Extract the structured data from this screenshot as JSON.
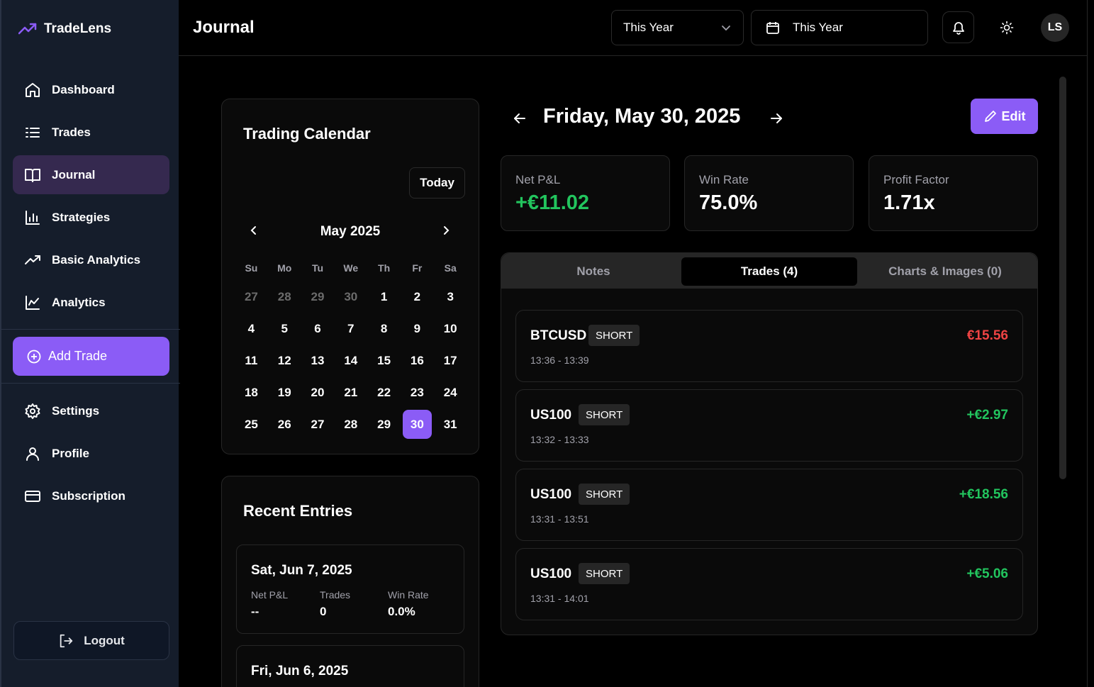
{
  "brand": {
    "name": "TradeLens"
  },
  "sidebar": {
    "items": [
      {
        "label": "Dashboard",
        "icon": "home-icon"
      },
      {
        "label": "Trades",
        "icon": "list-icon"
      },
      {
        "label": "Journal",
        "icon": "book-icon",
        "active": true
      },
      {
        "label": "Strategies",
        "icon": "bar-chart-icon"
      },
      {
        "label": "Basic Analytics",
        "icon": "trending-up-icon"
      },
      {
        "label": "Analytics",
        "icon": "line-chart-icon"
      }
    ],
    "add_trade": "Add Trade",
    "items2": [
      {
        "label": "Settings",
        "icon": "gear-icon"
      },
      {
        "label": "Profile",
        "icon": "user-icon"
      },
      {
        "label": "Subscription",
        "icon": "credit-card-icon"
      }
    ],
    "logout": "Logout"
  },
  "header": {
    "title": "Journal",
    "period_select": "This Year",
    "date_range": "This Year",
    "avatar_initials": "LS"
  },
  "calendar": {
    "title": "Trading Calendar",
    "today_label": "Today",
    "month_label": "May 2025",
    "weekdays": [
      "Su",
      "Mo",
      "Tu",
      "We",
      "Th",
      "Fr",
      "Sa"
    ],
    "days": [
      "27",
      "28",
      "29",
      "30",
      "1",
      "2",
      "3",
      "4",
      "5",
      "6",
      "7",
      "8",
      "9",
      "10",
      "11",
      "12",
      "13",
      "14",
      "15",
      "16",
      "17",
      "18",
      "19",
      "20",
      "21",
      "22",
      "23",
      "24",
      "25",
      "26",
      "27",
      "28",
      "29",
      "30",
      "31"
    ],
    "muted_count": 4,
    "selected_index": 33
  },
  "recent": {
    "title": "Recent Entries",
    "entries": [
      {
        "date": "Sat, Jun 7, 2025",
        "pnl_label": "Net P&L",
        "pnl": "--",
        "trades_label": "Trades",
        "trades": "0",
        "winrate_label": "Win Rate",
        "winrate": "0.0%"
      },
      {
        "date": "Fri, Jun 6, 2025"
      }
    ]
  },
  "day": {
    "title": "Friday, May 30, 2025",
    "edit_label": "Edit",
    "stats": [
      {
        "label": "Net P&L",
        "value": "+€11.02",
        "positive": true
      },
      {
        "label": "Win Rate",
        "value": "75.0%"
      },
      {
        "label": "Profit Factor",
        "value": "1.71x"
      }
    ],
    "tabs": [
      "Notes",
      "Trades (4)",
      "Charts & Images (0)"
    ],
    "active_tab": 1,
    "trades": [
      {
        "symbol": "BTCUSD",
        "side": "SHORT",
        "time": "13:36 - 13:39",
        "pnl": "€15.56",
        "positive": false
      },
      {
        "symbol": "US100",
        "side": "SHORT",
        "time": "13:32 - 13:33",
        "pnl": "+€2.97",
        "positive": true
      },
      {
        "symbol": "US100",
        "side": "SHORT",
        "time": "13:31 - 13:51",
        "pnl": "+€18.56",
        "positive": true
      },
      {
        "symbol": "US100",
        "side": "SHORT",
        "time": "13:31 - 14:01",
        "pnl": "+€5.06",
        "positive": true
      }
    ]
  },
  "colors": {
    "accent": "#8b5cf6",
    "positive": "#22c55e",
    "negative": "#ef4444",
    "sidebar_bg": "#151d2b"
  }
}
